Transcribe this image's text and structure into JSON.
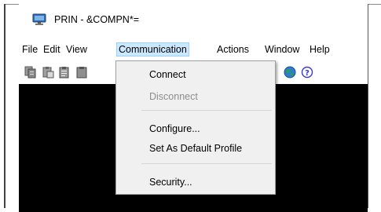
{
  "window": {
    "title": "PRIN - &COMPN*="
  },
  "menubar": {
    "items": [
      {
        "label": "File"
      },
      {
        "label": "Edit"
      },
      {
        "label": "View"
      },
      {
        "label": "Communication"
      },
      {
        "label": "Actions"
      },
      {
        "label": "Window"
      },
      {
        "label": "Help"
      }
    ]
  },
  "dropdown": {
    "items": [
      {
        "label": "Connect",
        "enabled": true
      },
      {
        "label": "Disconnect",
        "enabled": false
      },
      {
        "label": "Configure...",
        "enabled": true
      },
      {
        "label": "Set As Default Profile",
        "enabled": true
      },
      {
        "label": "Security...",
        "enabled": true
      }
    ]
  },
  "toolbar": {
    "icons": [
      "copy-icon",
      "paste-icon",
      "paste-special-icon",
      "clipboard-icon",
      "globe-icon",
      "help-icon"
    ]
  },
  "colors": {
    "menu_highlight": "#cce8ff",
    "menu_highlight_border": "#99d1ff",
    "terminal_bg": "#000000",
    "dropdown_bg": "#f0f0f0",
    "disabled_text": "#8d8d8d"
  }
}
